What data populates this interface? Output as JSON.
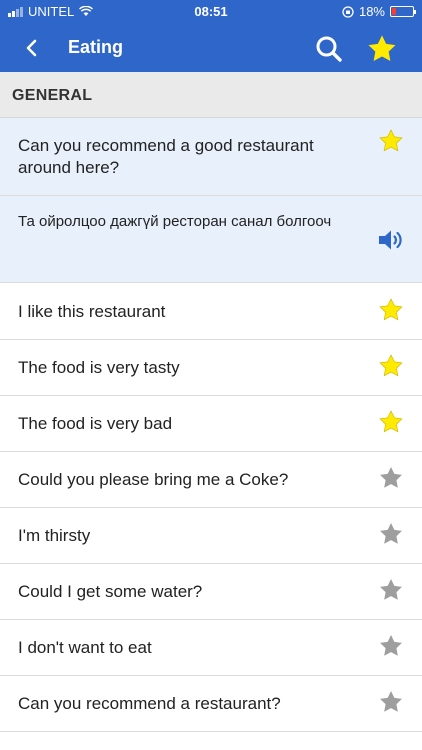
{
  "status_bar": {
    "carrier": "UNITEL",
    "time": "08:51",
    "battery_percent_label": "18%",
    "battery_level": 0.18,
    "battery_color": "#ff3b30"
  },
  "app_bar": {
    "title": "Eating",
    "color": "#2f66c9",
    "back_icon": "chevron-left-icon",
    "search_icon": "search-icon",
    "favorites_icon": "star-icon"
  },
  "section": {
    "title": "GENERAL"
  },
  "selected_phrase": {
    "text": "Can you recommend a good restaurant around here?",
    "favorite": true,
    "translation": "Та ойролцоо дажгүй ресторан санал болгооч",
    "audio_icon": "speaker-icon"
  },
  "phrases": [
    {
      "text": "I like this restaurant",
      "favorite": true
    },
    {
      "text": "The food is very tasty",
      "favorite": true
    },
    {
      "text": "The food is very bad",
      "favorite": true
    },
    {
      "text": "Could you please bring me a Coke?",
      "favorite": false
    },
    {
      "text": "I'm thirsty",
      "favorite": false
    },
    {
      "text": "Could I get some water?",
      "favorite": false
    },
    {
      "text": "I don't want to eat",
      "favorite": false
    },
    {
      "text": "Can you recommend a restaurant?",
      "favorite": false
    }
  ],
  "colors": {
    "star_on": "#ffea00",
    "star_off": "#9e9e9e",
    "speaker": "#2f66c9"
  }
}
